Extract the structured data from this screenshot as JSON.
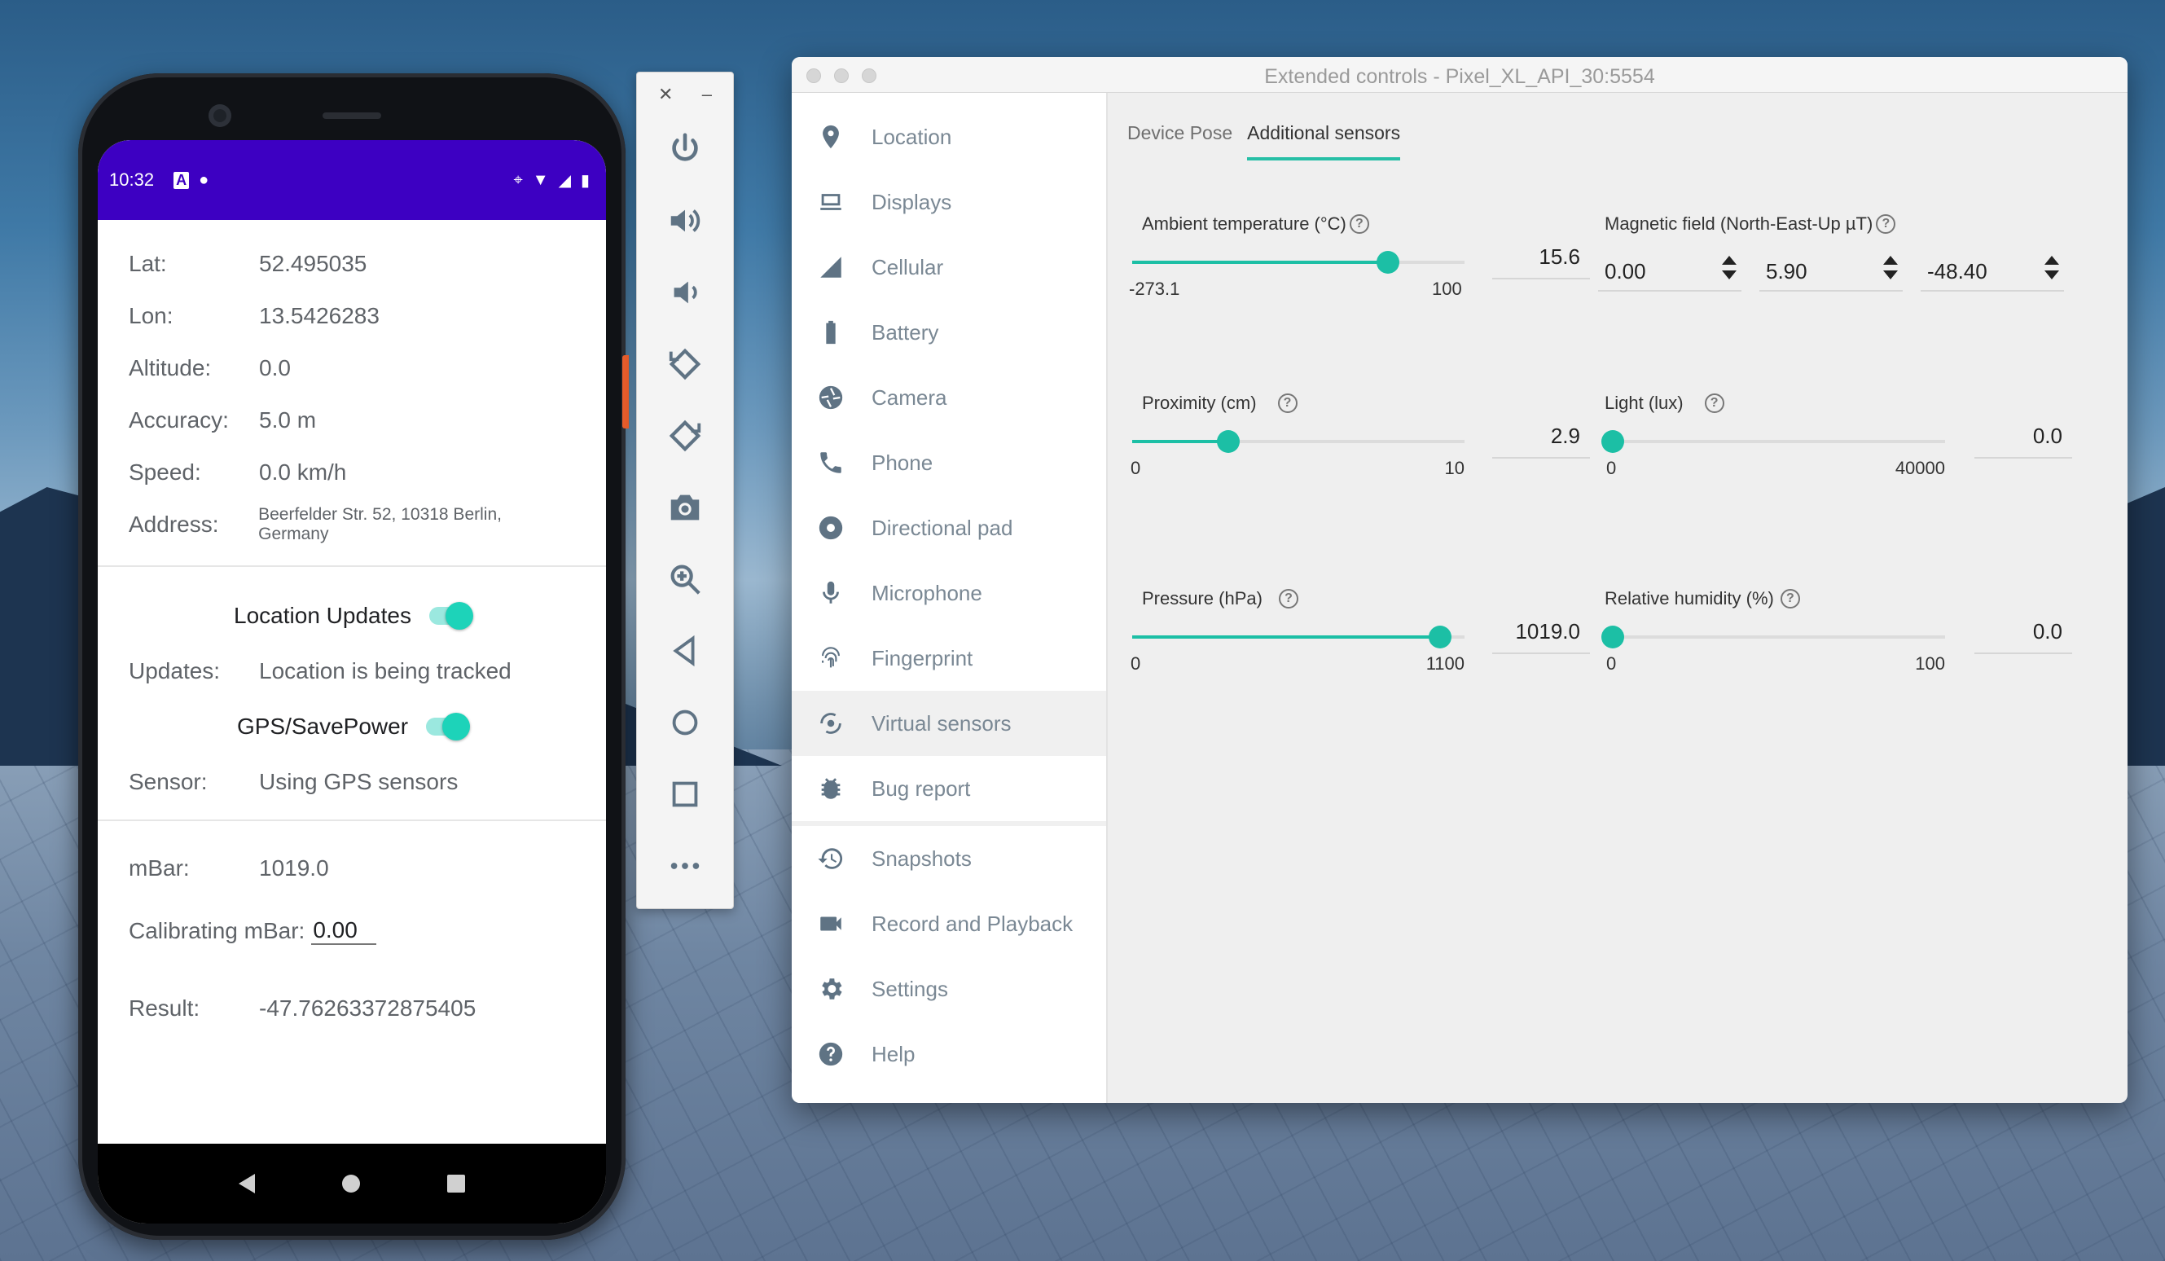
{
  "phone": {
    "status": {
      "time": "10:32"
    },
    "location": [
      {
        "label": "Lat:",
        "value": "52.495035"
      },
      {
        "label": "Lon:",
        "value": "13.5426283"
      },
      {
        "label": "Altitude:",
        "value": "0.0"
      },
      {
        "label": "Accuracy:",
        "value": "5.0 m"
      },
      {
        "label": "Speed:",
        "value": "0.0 km/h"
      },
      {
        "label": "Address:",
        "value": "Beerfelder Str. 52, 10318 Berlin, Germany"
      }
    ],
    "location_updates_label": "Location Updates",
    "location_updates_on": true,
    "updates_label": "Updates:",
    "updates_value": "Location is being tracked",
    "gps_label": "GPS/SavePower",
    "gps_on": true,
    "sensor_label": "Sensor:",
    "sensor_value": "Using GPS sensors",
    "mbar_label": "mBar:",
    "mbar_value": "1019.0",
    "calib_label": "Calibrating mBar:",
    "calib_value": "0.00",
    "result_label": "Result:",
    "result_value": "-47.76263372875405"
  },
  "toolbar": {
    "close": "✕",
    "minimize": "–",
    "buttons": [
      "power-icon",
      "volume-up-icon",
      "volume-down-icon",
      "rotate-left-icon",
      "rotate-right-icon",
      "screenshot-icon",
      "zoom-icon",
      "back-icon",
      "home-icon",
      "overview-icon",
      "more-icon"
    ]
  },
  "window": {
    "title": "Extended controls - Pixel_XL_API_30:5554",
    "sidebar": [
      {
        "label": "Location",
        "icon": "location-pin-icon"
      },
      {
        "label": "Displays",
        "icon": "display-icon"
      },
      {
        "label": "Cellular",
        "icon": "cellular-signal-icon"
      },
      {
        "label": "Battery",
        "icon": "battery-icon"
      },
      {
        "label": "Camera",
        "icon": "camera-aperture-icon"
      },
      {
        "label": "Phone",
        "icon": "phone-icon"
      },
      {
        "label": "Directional pad",
        "icon": "dpad-icon"
      },
      {
        "label": "Microphone",
        "icon": "microphone-icon"
      },
      {
        "label": "Fingerprint",
        "icon": "fingerprint-icon"
      },
      {
        "label": "Virtual sensors",
        "icon": "virtual-sensors-icon",
        "active": true
      },
      {
        "label": "Bug report",
        "icon": "bug-icon"
      },
      {
        "label": "Snapshots",
        "icon": "history-icon"
      },
      {
        "label": "Record and Playback",
        "icon": "video-camera-icon"
      },
      {
        "label": "Settings",
        "icon": "gear-icon"
      },
      {
        "label": "Help",
        "icon": "help-icon"
      }
    ],
    "tabs": [
      {
        "label": "Device Pose",
        "active": false
      },
      {
        "label": "Additional sensors",
        "active": true
      }
    ],
    "sensors": {
      "temperature": {
        "label": "Ambient temperature (°C)",
        "min": "-273.1",
        "max": "100",
        "value": "15.6",
        "fraction": 0.769
      },
      "proximity": {
        "label": "Proximity (cm)",
        "min": "0",
        "max": "10",
        "value": "2.9",
        "fraction": 0.29
      },
      "pressure": {
        "label": "Pressure (hPa)",
        "min": "0",
        "max": "1100",
        "value": "1019.0",
        "fraction": 0.926
      },
      "magnetic": {
        "label": "Magnetic field (North-East-Up µT)",
        "values": [
          "0.00",
          "5.90",
          "-48.40"
        ]
      },
      "light": {
        "label": "Light (lux)",
        "min": "0",
        "max": "40000",
        "value": "0.0",
        "fraction": 0.0
      },
      "humidity": {
        "label": "Relative humidity (%)",
        "min": "0",
        "max": "100",
        "value": "0.0",
        "fraction": 0.0
      }
    }
  }
}
